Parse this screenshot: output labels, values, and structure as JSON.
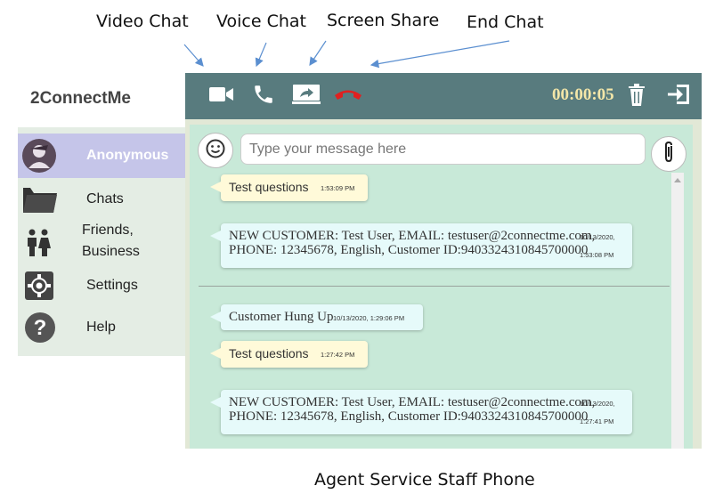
{
  "callouts": {
    "video_chat": "Video Chat",
    "voice_chat": "Voice Chat",
    "screen_share": "Screen Share",
    "end_chat": "End Chat"
  },
  "app": {
    "title": "2ConnectMe"
  },
  "sidebar": {
    "items": [
      {
        "label": "Anonymous",
        "icon": "user-avatar-icon",
        "active": true
      },
      {
        "label": "Chats",
        "icon": "folder-icon"
      },
      {
        "label_line1": "Friends,",
        "label_line2": "Business",
        "icon": "people-icon"
      },
      {
        "label": "Settings",
        "icon": "gear-icon"
      },
      {
        "label": "Help",
        "icon": "help-icon"
      }
    ]
  },
  "toolbar": {
    "icons": [
      "video-camera-icon",
      "phone-icon",
      "screen-share-icon",
      "end-call-icon",
      "trash-icon",
      "exit-icon"
    ],
    "timer": "00:00:05"
  },
  "composer": {
    "placeholder": "Type your message here"
  },
  "messages": [
    {
      "text": "Test questions",
      "time": "1:53:09 PM",
      "style": "yellow"
    },
    {
      "line1": "NEW CUSTOMER: Test User, EMAIL: testuser@2connectme.com,",
      "line2": "PHONE: 12345678, English, Customer ID:9403324310845700000",
      "time_line1": "10/13/2020,",
      "time_line2": "1:53:08 PM",
      "style": "cyan"
    },
    {
      "text": "Customer Hung Up",
      "time": "10/13/2020, 1:29:06 PM",
      "style": "cyan"
    },
    {
      "text": "Test questions",
      "time": "1:27:42 PM",
      "style": "yellow"
    },
    {
      "line1": "NEW CUSTOMER: Test User, EMAIL: testuser@2connectme.com,",
      "line2": "PHONE: 12345678, English, Customer ID:9403324310845700000",
      "time_line1": "10/13/2020,",
      "time_line2": "1:27:41 PM",
      "style": "cyan"
    }
  ],
  "caption": "Agent Service Staff Phone",
  "colors": {
    "toolbar_bg": "#587b7e",
    "chat_bg": "#c8e9d8",
    "sidebar_bg": "#e4ede4",
    "active_item_bg": "#c5c5e9",
    "end_call_red": "#e02020",
    "timer_text": "#f3e6a8",
    "bubble_yellow": "#fffad9",
    "bubble_cyan": "#e6fafa"
  }
}
